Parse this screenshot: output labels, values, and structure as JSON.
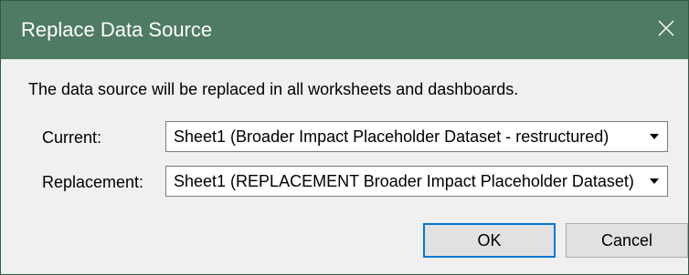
{
  "window": {
    "title": "Replace Data Source"
  },
  "message": "The data source will be replaced in all worksheets and dashboards.",
  "fields": {
    "current": {
      "label": "Current:",
      "value": "Sheet1 (Broader Impact Placeholder Dataset - restructured)"
    },
    "replacement": {
      "label": "Replacement:",
      "value": "Sheet1 (REPLACEMENT Broader Impact Placeholder Dataset)"
    }
  },
  "buttons": {
    "ok_label": "OK",
    "cancel_label": "Cancel"
  },
  "colors": {
    "titlebar": "#4f7b63",
    "dialog_bg": "#f0f0f0",
    "default_button_border": "#0078d7"
  },
  "icons": {
    "close": "close-icon",
    "dropdown": "chevron-down-icon"
  }
}
